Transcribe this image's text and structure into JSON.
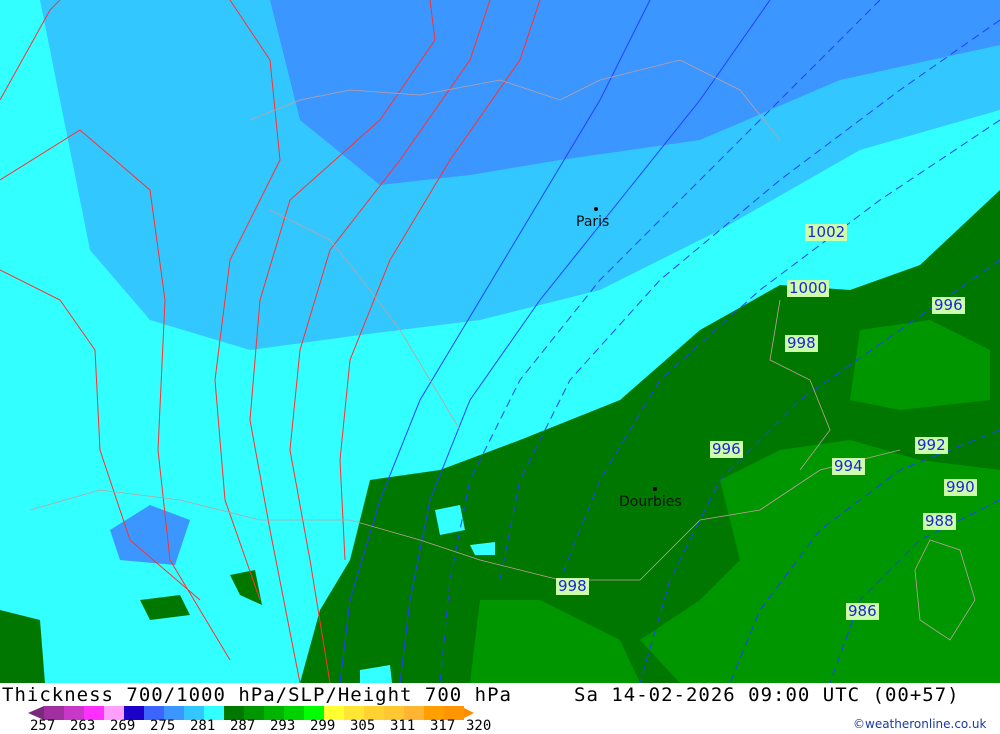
{
  "title": "Thickness 700/1000 hPa/SLP/Height 700 hPa",
  "datetime": "Sa 14-02-2026 09:00 UTC (00+57)",
  "credit": "©weatheronline.co.uk",
  "cities": [
    {
      "name": "Paris"
    },
    {
      "name": "Dourbies"
    }
  ],
  "isobar_labels": [
    "1002",
    "1000",
    "996",
    "998",
    "996",
    "992",
    "994",
    "990",
    "988",
    "998",
    "986"
  ],
  "legend": {
    "ticks": [
      "257",
      "263",
      "269",
      "275",
      "281",
      "287",
      "293",
      "299",
      "305",
      "311",
      "317",
      "320"
    ],
    "colors": [
      "#a030a0",
      "#c838c8",
      "#ff30ff",
      "#ffa0ff",
      "#1a00c8",
      "#3c64ff",
      "#3c96ff",
      "#32c8ff",
      "#32ffff",
      "#007800",
      "#009600",
      "#00b400",
      "#00d200",
      "#00ff00",
      "#ffff32",
      "#ffe632",
      "#ffd232",
      "#ffc832",
      "#ffb432",
      "#ffa000",
      "#ff9600"
    ]
  }
}
